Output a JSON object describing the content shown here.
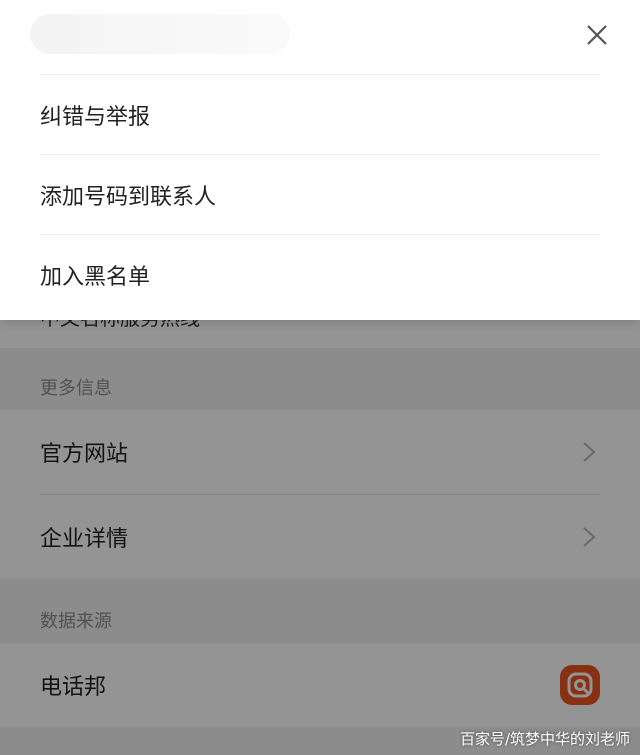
{
  "background": {
    "partial_item": "中文名称服务热线",
    "more_info_header": "更多信息",
    "more_info_items": [
      {
        "label": "官方网站"
      },
      {
        "label": "企业详情"
      }
    ],
    "data_source_header": "数据来源",
    "data_source_name": "电话邦",
    "data_source_logo": "dianhuabang-logo-icon"
  },
  "action_sheet": {
    "close_icon": "close-icon",
    "items": [
      {
        "label": "纠错与举报"
      },
      {
        "label": "添加号码到联系人"
      },
      {
        "label": "加入黑名单"
      }
    ]
  },
  "watermark": "百家号/筑梦中华的刘老师",
  "colors": {
    "overlay": "#000000",
    "logo_orange": "#e8551f",
    "secondary_text": "#8c8c8c"
  }
}
